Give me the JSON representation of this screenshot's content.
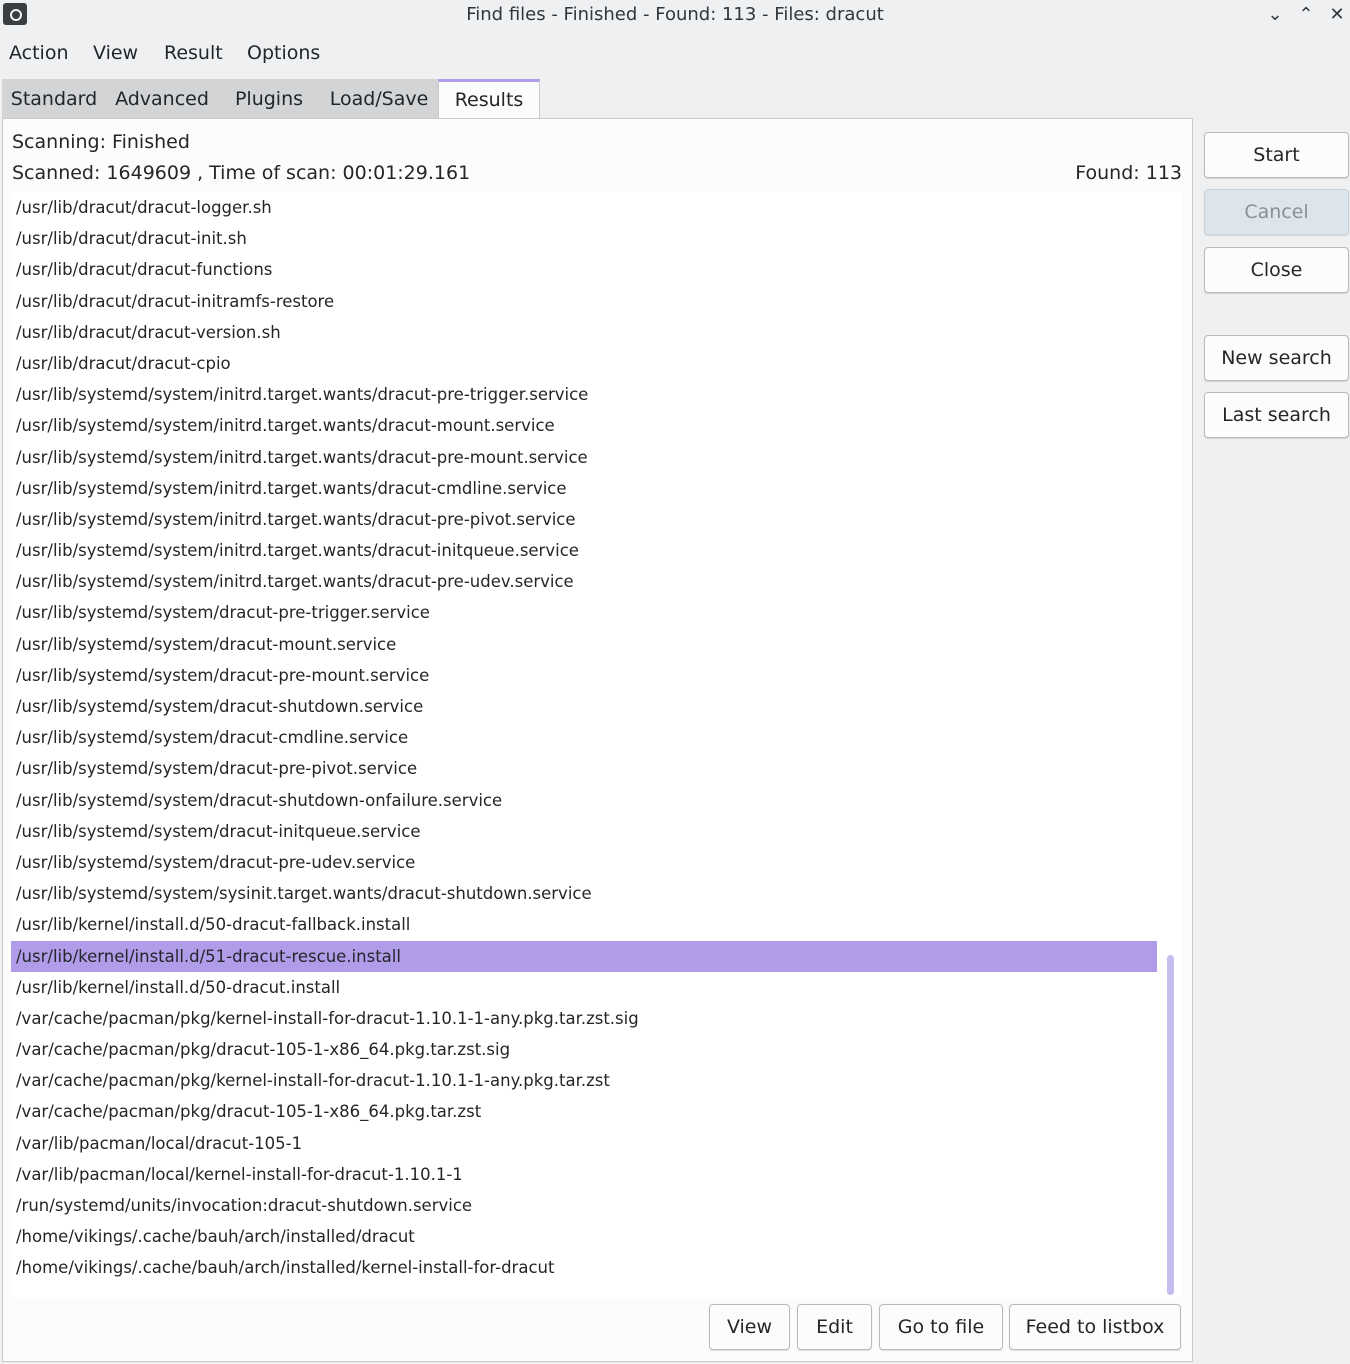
{
  "window": {
    "title": "Find files - Finished - Found: 113 - Files: dracut",
    "minimize_glyph": "⌄",
    "maximize_glyph": "⌃",
    "close_glyph": "✕"
  },
  "menu": [
    "Action",
    "View",
    "Result",
    "Options"
  ],
  "tabs": [
    "Standard",
    "Advanced",
    "Plugins",
    "Load/Save",
    "Results"
  ],
  "active_tab": "Results",
  "status": {
    "scanning": "Scanning: Finished",
    "scanned": "Scanned: 1649609 , Time of scan: 00:01:29.161",
    "found": "Found: 113"
  },
  "results": [
    "/usr/lib/dracut/dracut-logger.sh",
    "/usr/lib/dracut/dracut-init.sh",
    "/usr/lib/dracut/dracut-functions",
    "/usr/lib/dracut/dracut-initramfs-restore",
    "/usr/lib/dracut/dracut-version.sh",
    "/usr/lib/dracut/dracut-cpio",
    "/usr/lib/systemd/system/initrd.target.wants/dracut-pre-trigger.service",
    "/usr/lib/systemd/system/initrd.target.wants/dracut-mount.service",
    "/usr/lib/systemd/system/initrd.target.wants/dracut-pre-mount.service",
    "/usr/lib/systemd/system/initrd.target.wants/dracut-cmdline.service",
    "/usr/lib/systemd/system/initrd.target.wants/dracut-pre-pivot.service",
    "/usr/lib/systemd/system/initrd.target.wants/dracut-initqueue.service",
    "/usr/lib/systemd/system/initrd.target.wants/dracut-pre-udev.service",
    "/usr/lib/systemd/system/dracut-pre-trigger.service",
    "/usr/lib/systemd/system/dracut-mount.service",
    "/usr/lib/systemd/system/dracut-pre-mount.service",
    "/usr/lib/systemd/system/dracut-shutdown.service",
    "/usr/lib/systemd/system/dracut-cmdline.service",
    "/usr/lib/systemd/system/dracut-pre-pivot.service",
    "/usr/lib/systemd/system/dracut-shutdown-onfailure.service",
    "/usr/lib/systemd/system/dracut-initqueue.service",
    "/usr/lib/systemd/system/dracut-pre-udev.service",
    "/usr/lib/systemd/system/sysinit.target.wants/dracut-shutdown.service",
    "/usr/lib/kernel/install.d/50-dracut-fallback.install",
    "/usr/lib/kernel/install.d/51-dracut-rescue.install",
    "/usr/lib/kernel/install.d/50-dracut.install",
    "/var/cache/pacman/pkg/kernel-install-for-dracut-1.10.1-1-any.pkg.tar.zst.sig",
    "/var/cache/pacman/pkg/dracut-105-1-x86_64.pkg.tar.zst.sig",
    "/var/cache/pacman/pkg/kernel-install-for-dracut-1.10.1-1-any.pkg.tar.zst",
    "/var/cache/pacman/pkg/dracut-105-1-x86_64.pkg.tar.zst",
    "/var/lib/pacman/local/dracut-105-1",
    "/var/lib/pacman/local/kernel-install-for-dracut-1.10.1-1",
    "/run/systemd/units/invocation:dracut-shutdown.service",
    "/home/vikings/.cache/bauh/arch/installed/dracut",
    "/home/vikings/.cache/bauh/arch/installed/kernel-install-for-dracut"
  ],
  "selected_index": 24,
  "side_buttons": {
    "start": "Start",
    "cancel": "Cancel",
    "close": "Close",
    "new_search": "New search",
    "last_search": "Last search"
  },
  "bottom_buttons": {
    "view": "View",
    "edit": "Edit",
    "go_to_file": "Go to file",
    "feed_to_listbox": "Feed to listbox"
  },
  "colors": {
    "selection": "#b09ce8",
    "scrollbar": "#c7bcf0"
  }
}
